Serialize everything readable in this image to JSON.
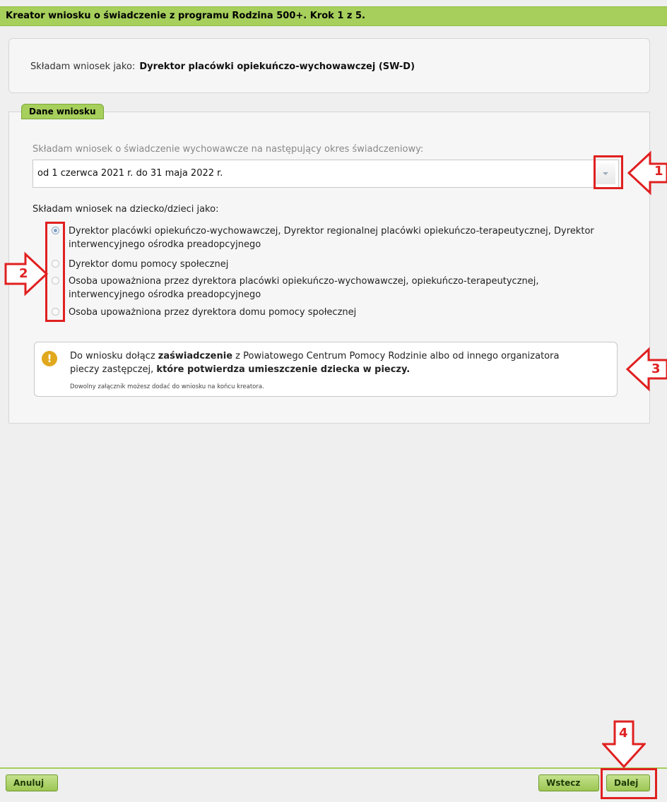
{
  "window": {
    "title": "Kreator wniosku o świadczenie z programu Rodzina 500+. Krok 1 z 5."
  },
  "role": {
    "label": "Składam wniosek jako:",
    "value": "Dyrektor placówki opiekuńczo-wychowawczej (SW-D)"
  },
  "section": {
    "legend": "Dane wniosku",
    "period_label": "Składam wniosek o świadczenie wychowawcze na następujący okres świadczeniowy:",
    "period_value": "od 1 czerwca 2021 r. do 31 maja 2022 r.",
    "as_label": "Składam wniosek na dziecko/dzieci jako:",
    "options": [
      {
        "line1": "Dyrektor placówki opiekuńczo-wychowawczej, Dyrektor regionalnej placówki opiekuńczo-terapeutycznej, Dyrektor",
        "line2": "interwencyjnego ośrodka preadopcyjnego",
        "checked": true
      },
      {
        "line1": "Dyrektor domu pomocy społecznej",
        "line2": "",
        "checked": false
      },
      {
        "line1": "Osoba upoważniona przez dyrektora placówki opiekuńczo-wychowawczej, opiekuńczo-terapeutycznej,",
        "line2": "interwencyjnego ośrodka preadopcyjnego",
        "checked": false
      },
      {
        "line1": "Osoba upoważniona przez dyrektora domu pomocy społecznej",
        "line2": "",
        "checked": false
      }
    ]
  },
  "info": {
    "icon": "warning-icon",
    "part1": "Do wniosku dołącz ",
    "bold1": "zaświadczenie",
    "part2": " z Powiatowego Centrum Pomocy Rodzinie albo od innego organizatora",
    "part3": "pieczy zastępczej, ",
    "bold2": "które potwierdza umieszczenie dziecka w pieczy.",
    "small": "Dowolny załącznik możesz dodać do wniosku na końcu kreatora."
  },
  "buttons": {
    "cancel": "Anuluj",
    "back": "Wstecz",
    "next": "Dalej"
  },
  "annotations": {
    "n1": "1",
    "n2": "2",
    "n3": "3",
    "n4": "4"
  },
  "colors": {
    "accent_green": "#a6cf5c",
    "annotation_red": "#e02020",
    "warning_orange": "#e1a81e"
  }
}
